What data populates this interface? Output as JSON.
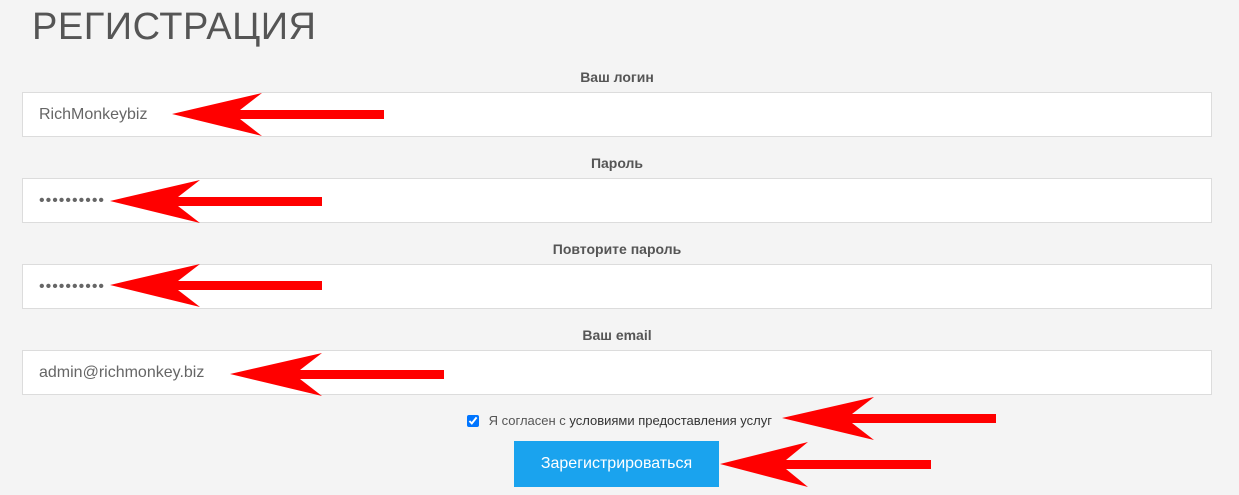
{
  "page": {
    "title": "РЕГИСТРАЦИЯ"
  },
  "form": {
    "login": {
      "label": "Ваш логин",
      "value": "RichMonkeybiz"
    },
    "password": {
      "label": "Пароль",
      "value": "••••••••••"
    },
    "password_repeat": {
      "label": "Повторите пароль",
      "value": "••••••••••"
    },
    "email": {
      "label": "Ваш email",
      "value": "admin@richmonkey.biz"
    },
    "agree": {
      "checked": true,
      "text_prefix": "Я согласен с ",
      "link_text": "условиями предоставления услуг"
    },
    "submit_label": "Зарегистрироваться"
  },
  "annotations": {
    "arrow_color": "#ff0000"
  },
  "colors": {
    "background": "#f4f4f4",
    "button": "#1aa3ee",
    "button_text": "#ffffff"
  }
}
